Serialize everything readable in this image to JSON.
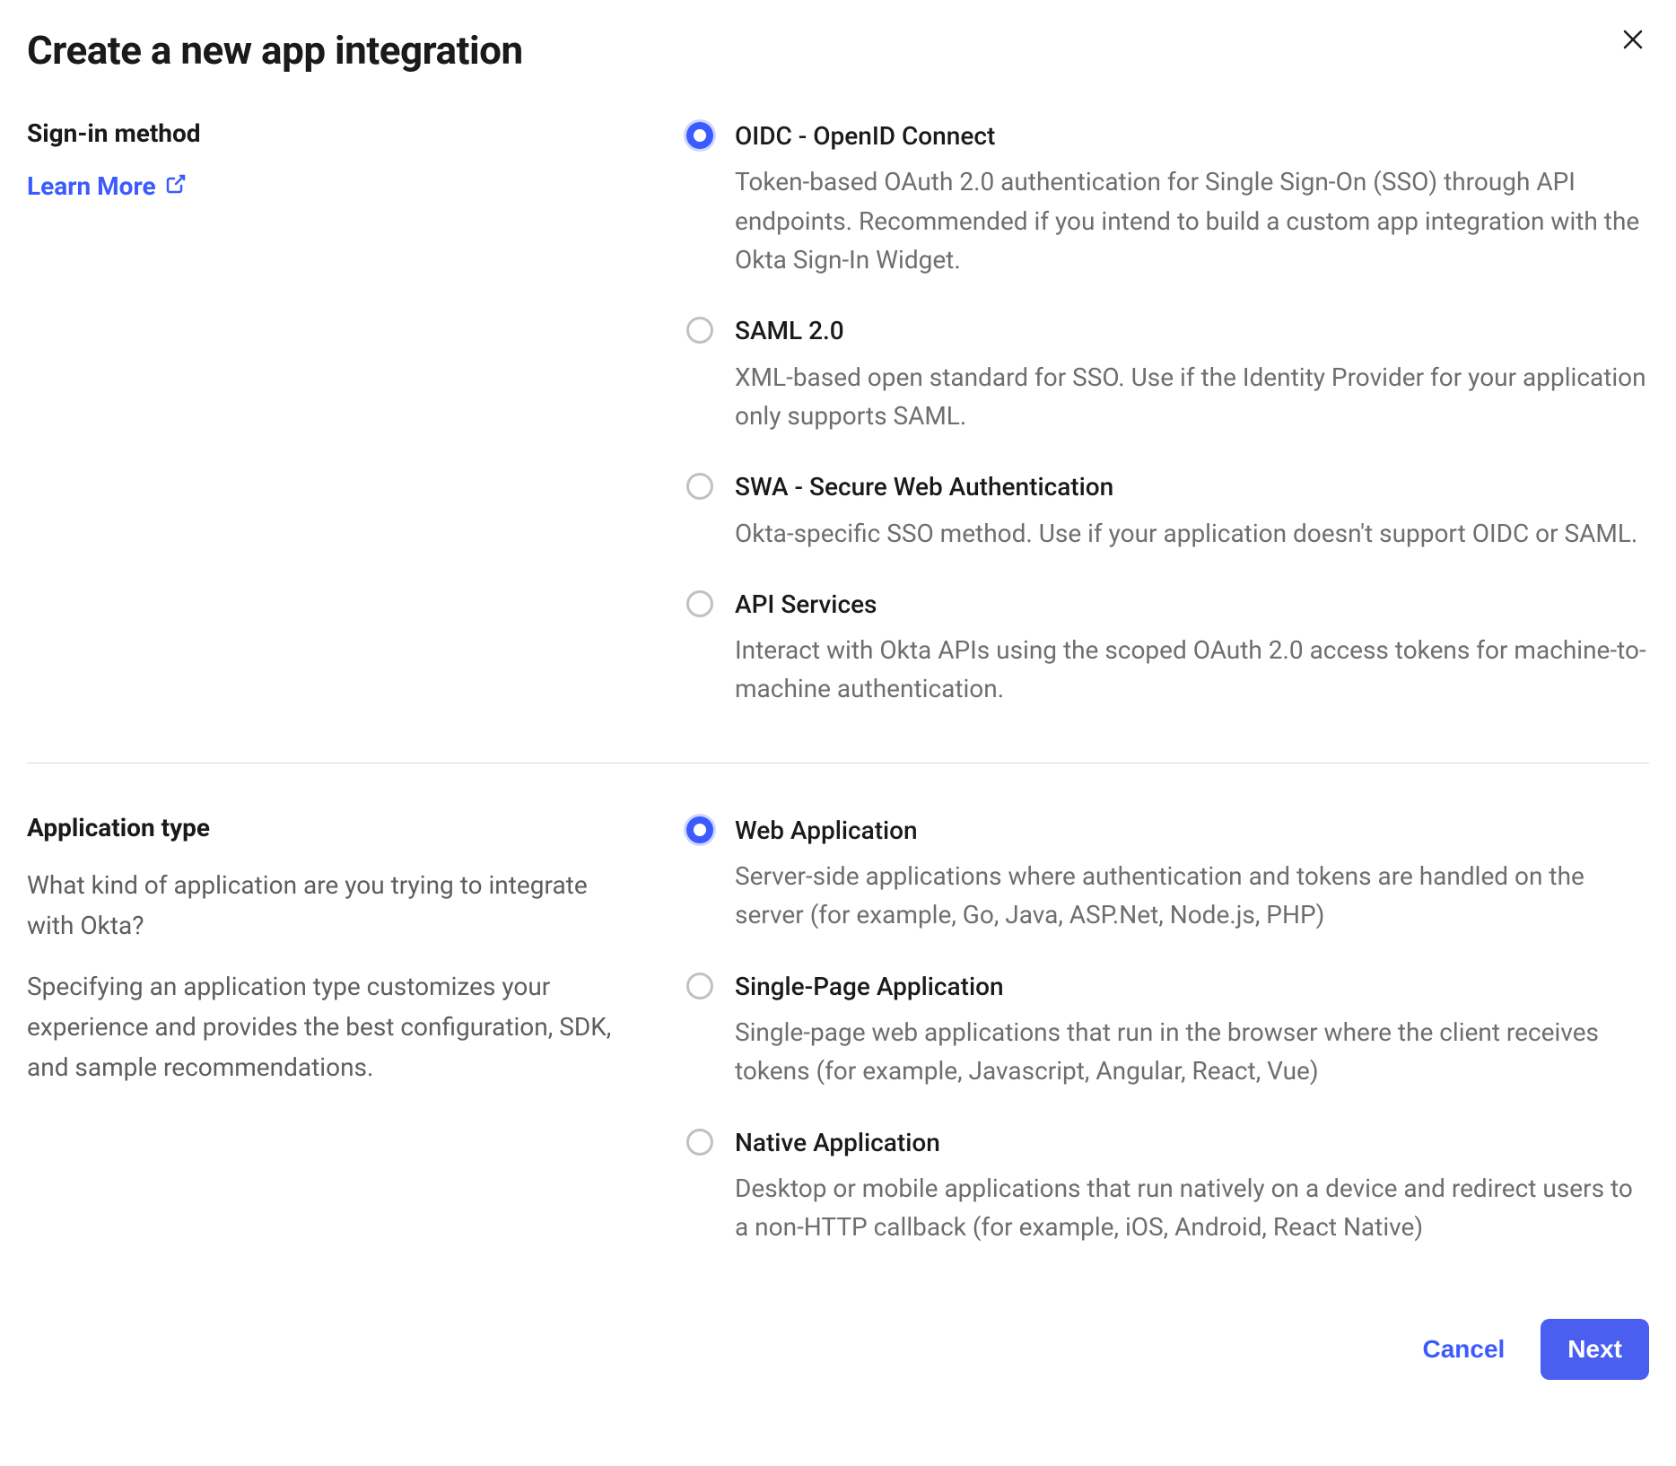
{
  "title": "Create a new app integration",
  "close_label": "Close",
  "sections": {
    "signin": {
      "heading": "Sign-in method",
      "learn_more": "Learn More",
      "options": [
        {
          "title": "OIDC - OpenID Connect",
          "desc": "Token-based OAuth 2.0 authentication for Single Sign-On (SSO) through API endpoints. Recommended if you intend to build a custom app integration with the Okta Sign-In Widget.",
          "selected": true
        },
        {
          "title": "SAML 2.0",
          "desc": "XML-based open standard for SSO. Use if the Identity Provider for your application only supports SAML.",
          "selected": false
        },
        {
          "title": "SWA - Secure Web Authentication",
          "desc": "Okta-specific SSO method. Use if your application doesn't support OIDC or SAML.",
          "selected": false
        },
        {
          "title": "API Services",
          "desc": "Interact with Okta APIs using the scoped OAuth 2.0 access tokens for machine-to-machine authentication.",
          "selected": false
        }
      ]
    },
    "apptype": {
      "heading": "Application type",
      "desc1": "What kind of application are you trying to integrate with Okta?",
      "desc2": "Specifying an application type customizes your experience and provides the best configuration, SDK, and sample recommendations.",
      "options": [
        {
          "title": "Web Application",
          "desc": "Server-side applications where authentication and tokens are handled on the server (for example, Go, Java, ASP.Net, Node.js, PHP)",
          "selected": true
        },
        {
          "title": "Single-Page Application",
          "desc": "Single-page web applications that run in the browser where the client receives tokens (for example, Javascript, Angular, React, Vue)",
          "selected": false
        },
        {
          "title": "Native Application",
          "desc": "Desktop or mobile applications that run natively on a device and redirect users to a non-HTTP callback (for example, iOS, Android, React Native)",
          "selected": false
        }
      ]
    }
  },
  "footer": {
    "cancel": "Cancel",
    "next": "Next"
  }
}
